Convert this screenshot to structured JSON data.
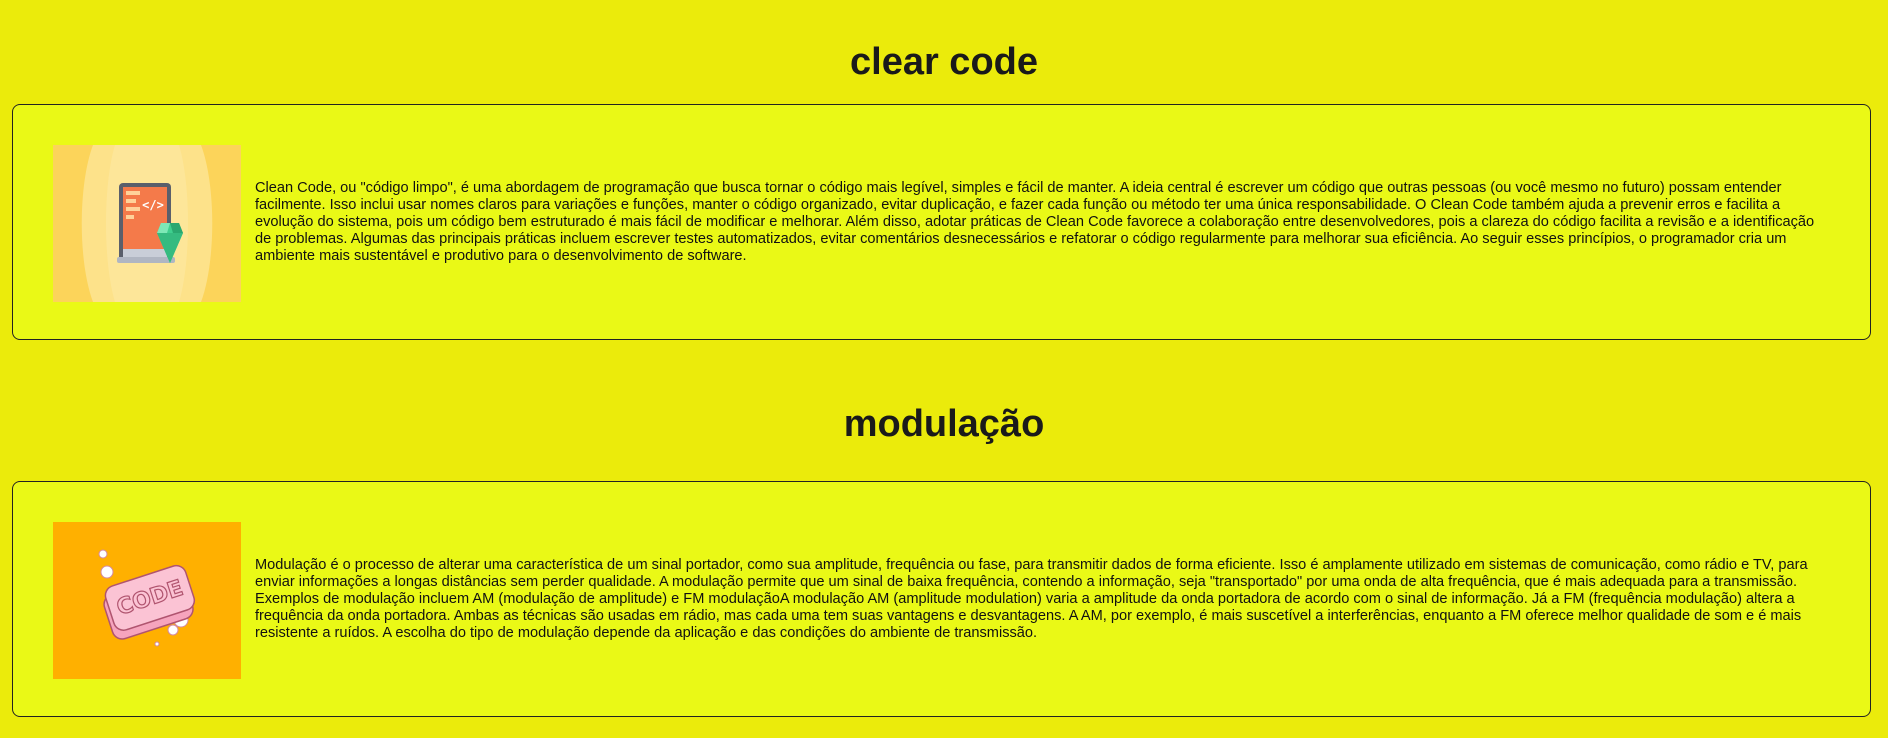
{
  "sections": [
    {
      "title": "clear code",
      "image_icon": "tablet-code-gem-illustration",
      "text": "Clean Code, ou \"código limpo\", é uma abordagem de programação que busca tornar o código mais legível, simples e fácil de manter. A ideia central é escrever um código que outras pessoas (ou você mesmo no futuro) possam entender facilmente. Isso inclui usar nomes claros para variações e funções, manter o código organizado, evitar duplicação, e fazer cada função ou método ter uma única responsabilidade. O Clean Code também ajuda a prevenir erros e facilita a evolução do sistema, pois um código bem estruturado é mais fácil de modificar e melhorar. Além disso, adotar práticas de Clean Code favorece a colaboração entre desenvolvedores, pois a clareza do código facilita a revisão e a identificação de problemas. Algumas das principais práticas incluem escrever testes automatizados, evitar comentários desnecessários e refatorar o código regularmente para melhorar sua eficiência. Ao seguir esses princípios, o programador cria um ambiente mais sustentável e produtivo para o desenvolvimento de software."
    },
    {
      "title": "modulação",
      "image_icon": "code-soap-bar-illustration",
      "image_text": "CODE",
      "text": "Modulação é o processo de alterar uma característica de um sinal portador, como sua amplitude, frequência ou fase, para transmitir dados de forma eficiente. Isso é amplamente utilizado em sistemas de comunicação, como rádio e TV, para enviar informações a longas distâncias sem perder qualidade. A modulação permite que um sinal de baixa frequência, contendo a informação, seja \"transportado\" por uma onda de alta frequência, que é mais adequada para a transmissão. Exemplos de modulação incluem AM (modulação de amplitude) e FM modulaçãoA modulação AM (amplitude modulation) varia a amplitude da onda portadora de acordo com o sinal de informação. Já a FM (frequência modulação) altera a frequência da onda portadora. Ambas as técnicas são usadas em rádio, mas cada uma tem suas vantagens e desvantagens. A AM, por exemplo, é mais suscetível a interferências, enquanto a FM oferece melhor qualidade de som e é mais resistente a ruídos. A escolha do tipo de modulação depende da aplicação e das condições do ambiente de transmissão."
    }
  ],
  "colors": {
    "page_background": "#ebeb0b",
    "card_background": "#eaf916",
    "card_border": "#222222"
  }
}
